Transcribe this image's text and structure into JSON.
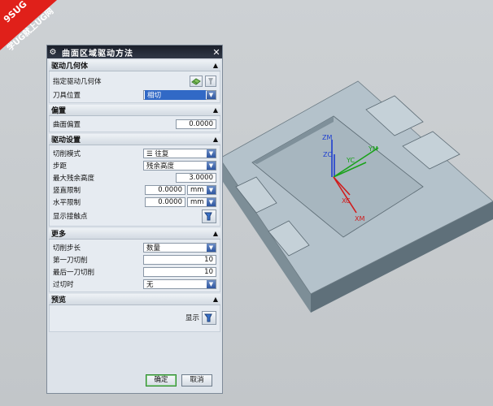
{
  "watermark": {
    "line1": "9SUG",
    "line2": "学UG就上UG网"
  },
  "dialog": {
    "title": "曲面区域驱动方法",
    "sections": {
      "geometry": {
        "header": "驱动几何体",
        "specify_label": "指定驱动几何体",
        "tool_position_label": "刀具位置",
        "tool_position_value": "相切"
      },
      "offset": {
        "header": "偏置",
        "surface_offset_label": "曲面偏置",
        "surface_offset_value": "0.0000"
      },
      "drive": {
        "header": "驱动设置",
        "cut_pattern_label": "切削模式",
        "cut_pattern_value": "往复",
        "stepover_label": "步距",
        "stepover_value": "残余高度",
        "max_scallop_label": "最大残余高度",
        "max_scallop_value": "3.0000",
        "vertical_limit_label": "竖直限制",
        "vertical_limit_value": "0.0000",
        "vertical_limit_unit": "mm",
        "horizontal_limit_label": "水平限制",
        "horizontal_limit_value": "0.0000",
        "horizontal_limit_unit": "mm",
        "show_contact_label": "显示接触点"
      },
      "more": {
        "header": "更多",
        "cut_step_label": "切削步长",
        "cut_step_value": "数量",
        "first_cut_label": "第一刀切削",
        "first_cut_value": "10",
        "last_cut_label": "最后一刀切削",
        "last_cut_value": "10",
        "overcut_label": "过切时",
        "overcut_value": "无"
      },
      "preview": {
        "header": "预览",
        "display_label": "显示"
      }
    },
    "ok_label": "确定",
    "cancel_label": "取消"
  },
  "axes": {
    "zm": "ZM",
    "zc": "ZC",
    "yc": "YC",
    "ym": "YM",
    "xc": "XC",
    "xm": "XM"
  },
  "colors": {
    "titlebar": "#1f2530",
    "selection": "#3169c6",
    "part_top": "#b7c4cd",
    "part_side": "#6f8089",
    "watermark": "#e0201a"
  }
}
